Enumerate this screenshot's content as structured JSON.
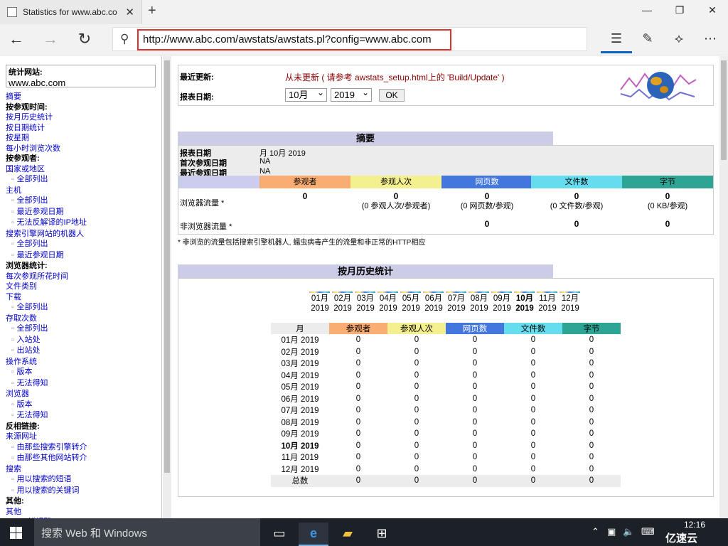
{
  "browser": {
    "tab_title": "Statistics for www.abc.co",
    "url": "http://www.abc.com/awstats/awstats.pl?config=www.abc.com"
  },
  "sidebar": {
    "site_label": "统计网站:",
    "site_value": "www.abc.com",
    "items": [
      {
        "t": "摘要",
        "k": "l"
      },
      {
        "t": "按参观时间:",
        "k": "h"
      },
      {
        "t": "按月历史统计",
        "k": "l"
      },
      {
        "t": "按日期统计",
        "k": "l"
      },
      {
        "t": "按星期",
        "k": "l"
      },
      {
        "t": "每小时浏览次数",
        "k": "l"
      },
      {
        "t": "按参观者:",
        "k": "h"
      },
      {
        "t": "国家或地区",
        "k": "l"
      },
      {
        "t": "全部列出",
        "k": "s"
      },
      {
        "t": "主机",
        "k": "l"
      },
      {
        "t": "全部列出",
        "k": "s"
      },
      {
        "t": "最近参观日期",
        "k": "s"
      },
      {
        "t": "无法反解译的IP地址",
        "k": "s"
      },
      {
        "t": "搜索引擎网站的机器人",
        "k": "l"
      },
      {
        "t": "全部列出",
        "k": "s"
      },
      {
        "t": "最近参观日期",
        "k": "s"
      },
      {
        "t": "浏览器统计:",
        "k": "h"
      },
      {
        "t": "每次参观所花时间",
        "k": "l"
      },
      {
        "t": "文件类别",
        "k": "l"
      },
      {
        "t": "下载",
        "k": "l"
      },
      {
        "t": "全部列出",
        "k": "s"
      },
      {
        "t": "存取次数",
        "k": "l"
      },
      {
        "t": "全部列出",
        "k": "s"
      },
      {
        "t": "入站处",
        "k": "s"
      },
      {
        "t": "出站处",
        "k": "s"
      },
      {
        "t": "操作系统",
        "k": "l"
      },
      {
        "t": "版本",
        "k": "s"
      },
      {
        "t": "无法得知",
        "k": "s"
      },
      {
        "t": "浏览器",
        "k": "l"
      },
      {
        "t": "版本",
        "k": "s"
      },
      {
        "t": "无法得知",
        "k": "s"
      },
      {
        "t": "反相链接:",
        "k": "h"
      },
      {
        "t": "来源网址",
        "k": "l"
      },
      {
        "t": "由那些搜索引擎转介",
        "k": "s"
      },
      {
        "t": "由那些其他网站转介",
        "k": "s"
      },
      {
        "t": "搜索",
        "k": "l"
      },
      {
        "t": "用以搜索的短语",
        "k": "s"
      },
      {
        "t": "用以搜索的关键词",
        "k": "s"
      },
      {
        "t": "其他:",
        "k": "h"
      },
      {
        "t": "其他",
        "k": "l"
      },
      {
        "t": "HTTP 错误码",
        "k": "l"
      }
    ]
  },
  "header": {
    "last_update_label": "最近更新:",
    "last_update_value": "从未更新 ( 请参考 awstats_setup.html上的 'Build/Update' )",
    "report_date_label": "报表日期:",
    "month_select": "10月",
    "year_select": "2019",
    "ok_label": "OK"
  },
  "summary": {
    "title": "摘要",
    "report_date_label": "报表日期",
    "report_date_value": "月 10月 2019",
    "first_visit_label": "首次参观日期",
    "first_visit_value": "NA",
    "last_visit_label": "最近参观日期",
    "last_visit_value": "NA",
    "columns": [
      "参观者",
      "参观人次",
      "网页数",
      "文件数",
      "字节"
    ],
    "column_colors": [
      "#f9ad72",
      "#f4f090",
      "#4477dd",
      "#66ddee",
      "#2ea495"
    ],
    "browser_traffic_label": "浏览器流量 *",
    "browser_traffic": [
      "0",
      "0",
      "0",
      "0",
      "0"
    ],
    "browser_traffic_sub": [
      "",
      "(0 参观人次/参观者)",
      "(0 网页数/参观)",
      "(0 文件数/参观)",
      "(0 KB/参观)"
    ],
    "non_browser_label": "非浏览器流量 *",
    "non_browser": [
      "",
      "",
      "0",
      "0",
      "0"
    ],
    "note": "* 非浏览的流量包括搜索引擎机器人, 蠕虫病毒产生的流量和非正常的HTTP相应"
  },
  "monthly": {
    "title": "按月历史统计",
    "months": [
      "01月",
      "02月",
      "03月",
      "04月",
      "05月",
      "06月",
      "07月",
      "08月",
      "09月",
      "10月",
      "11月",
      "12月"
    ],
    "year": "2019",
    "current_index": 9,
    "table_header": [
      "月",
      "参观者",
      "参观人次",
      "网页数",
      "文件数",
      "字节"
    ],
    "rows": [
      [
        "01月 2019",
        "0",
        "0",
        "0",
        "0",
        "0"
      ],
      [
        "02月 2019",
        "0",
        "0",
        "0",
        "0",
        "0"
      ],
      [
        "03月 2019",
        "0",
        "0",
        "0",
        "0",
        "0"
      ],
      [
        "04月 2019",
        "0",
        "0",
        "0",
        "0",
        "0"
      ],
      [
        "05月 2019",
        "0",
        "0",
        "0",
        "0",
        "0"
      ],
      [
        "06月 2019",
        "0",
        "0",
        "0",
        "0",
        "0"
      ],
      [
        "07月 2019",
        "0",
        "0",
        "0",
        "0",
        "0"
      ],
      [
        "08月 2019",
        "0",
        "0",
        "0",
        "0",
        "0"
      ],
      [
        "09月 2019",
        "0",
        "0",
        "0",
        "0",
        "0"
      ],
      [
        "10月 2019",
        "0",
        "0",
        "0",
        "0",
        "0"
      ],
      [
        "11月 2019",
        "0",
        "0",
        "0",
        "0",
        "0"
      ],
      [
        "12月 2019",
        "0",
        "0",
        "0",
        "0",
        "0"
      ]
    ],
    "total_row": [
      "总数",
      "0",
      "0",
      "0",
      "0",
      "0"
    ]
  },
  "taskbar": {
    "search_placeholder": "搜索 Web 和 Windows",
    "time": "12:16",
    "brand": "亿速云"
  }
}
